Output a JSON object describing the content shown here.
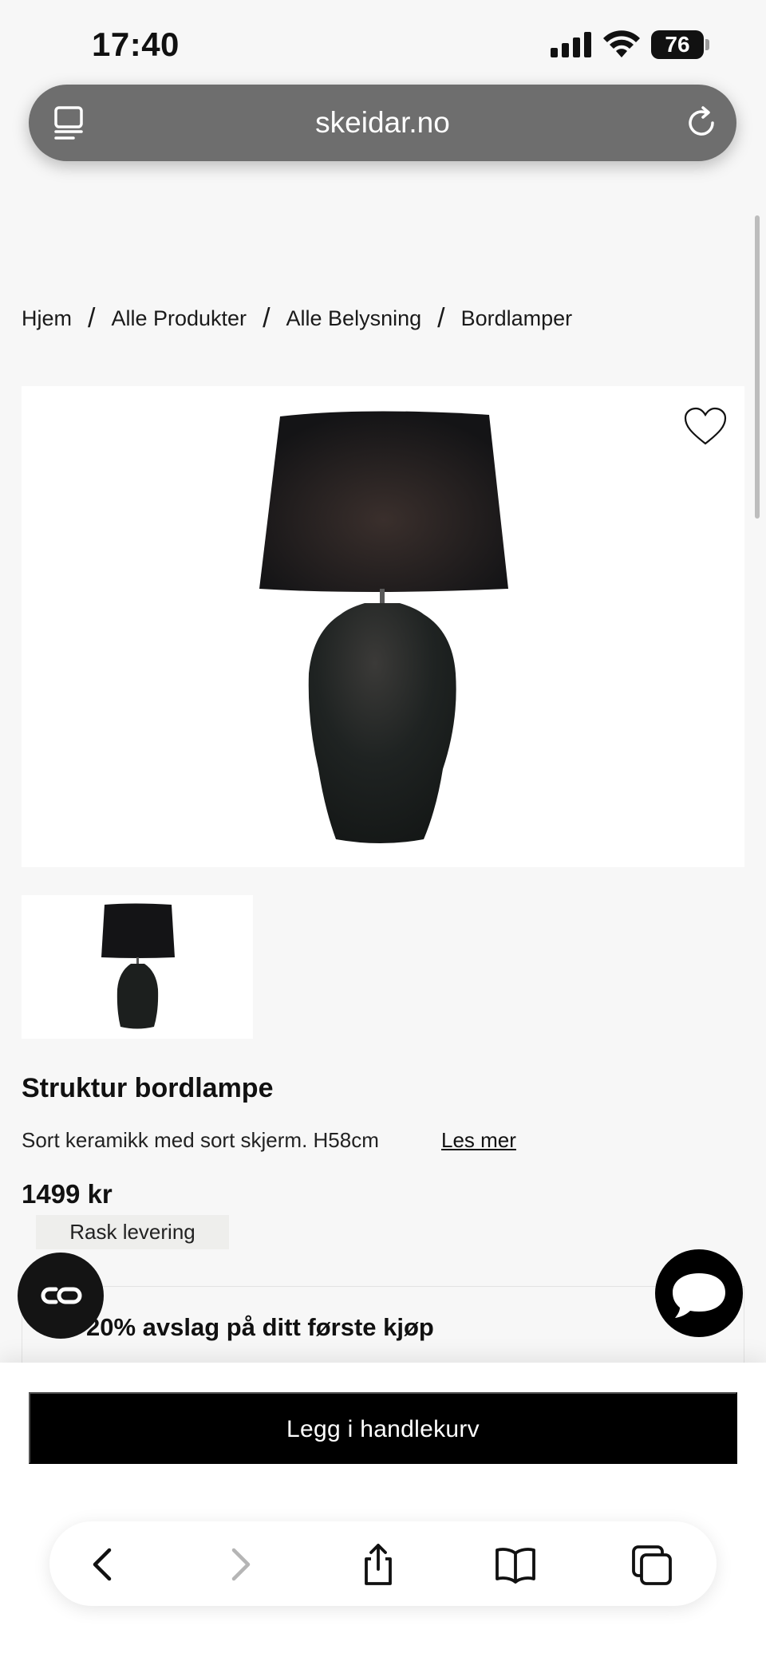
{
  "status_bar": {
    "time": "17:40",
    "battery": "76"
  },
  "browser": {
    "url": "skeidar.no"
  },
  "breadcrumb": [
    "Hjem",
    "Alle Produkter",
    "Alle Belysning",
    "Bordlamper"
  ],
  "product": {
    "title": "Struktur bordlampe",
    "description": "Sort keramikk med sort skjerm. H58cm",
    "read_more": "Les mer",
    "price": "1499 kr",
    "delivery_badge": "Rask levering"
  },
  "promo": {
    "text": "20% avslag på ditt første kjøp"
  },
  "cart": {
    "add_label": "Legg i handlekurv"
  },
  "colors": {
    "background": "#f7f7f7",
    "button": "#000000",
    "url_bar": "#6e6e6e"
  },
  "icons": {
    "tabs": "tabs-icon",
    "reload": "reload-icon",
    "favorite": "heart-icon",
    "back": "chevron-left-icon",
    "forward": "chevron-right-icon",
    "share": "share-icon",
    "bookmarks": "book-icon",
    "tab_switcher": "tabs-overview-icon",
    "chat": "chat-icon",
    "co": "co-icon"
  }
}
